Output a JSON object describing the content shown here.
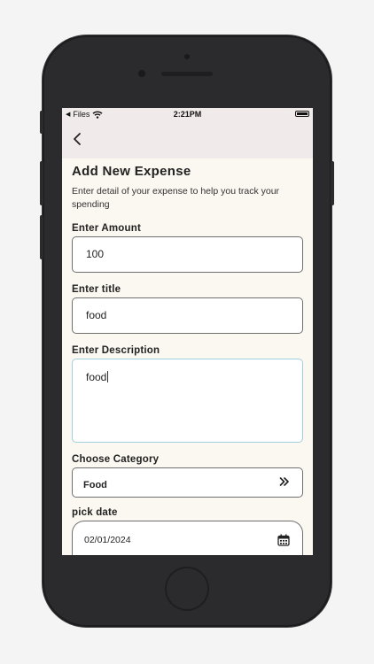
{
  "status_bar": {
    "back_app": "Files",
    "time": "2:21PM"
  },
  "page": {
    "title": "Add New Expense",
    "subtitle": "Enter detail of your expense to help you track your spending"
  },
  "form": {
    "amount": {
      "label": "Enter Amount",
      "value": "100"
    },
    "title": {
      "label": "Enter title",
      "value": "food"
    },
    "description": {
      "label": "Enter Description",
      "value": "food"
    },
    "category": {
      "label": "Choose Category",
      "value": "Food"
    },
    "date": {
      "label": "pick date",
      "value": "02/01/2024"
    }
  },
  "icons": {
    "back": "chevron-left-icon",
    "category_select": "double-chevron-right-icon",
    "date_picker": "calendar-icon",
    "wifi": "wifi-icon",
    "battery": "battery-icon"
  }
}
